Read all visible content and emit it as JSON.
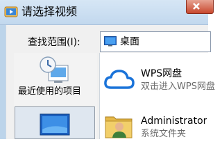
{
  "window": {
    "title": "请选择视频"
  },
  "lookin": {
    "label": "查找范围(I):",
    "value": "桌面"
  },
  "places": {
    "recent_label": "最近使用的项目"
  },
  "files": [
    {
      "name": "WPS网盘",
      "description": "双击进入WPS网盘"
    },
    {
      "name": "Administrator",
      "description": "系统文件夹"
    }
  ],
  "colors": {
    "titlebar": "#c9dcf0",
    "accent": "#1a73d9",
    "close": "#c8482e"
  },
  "icons": [
    "video-dialog-icon",
    "close-icon",
    "desktop-icon",
    "recent-items-icon",
    "desktop-place-icon",
    "wps-cloud-icon",
    "user-folder-icon"
  ]
}
